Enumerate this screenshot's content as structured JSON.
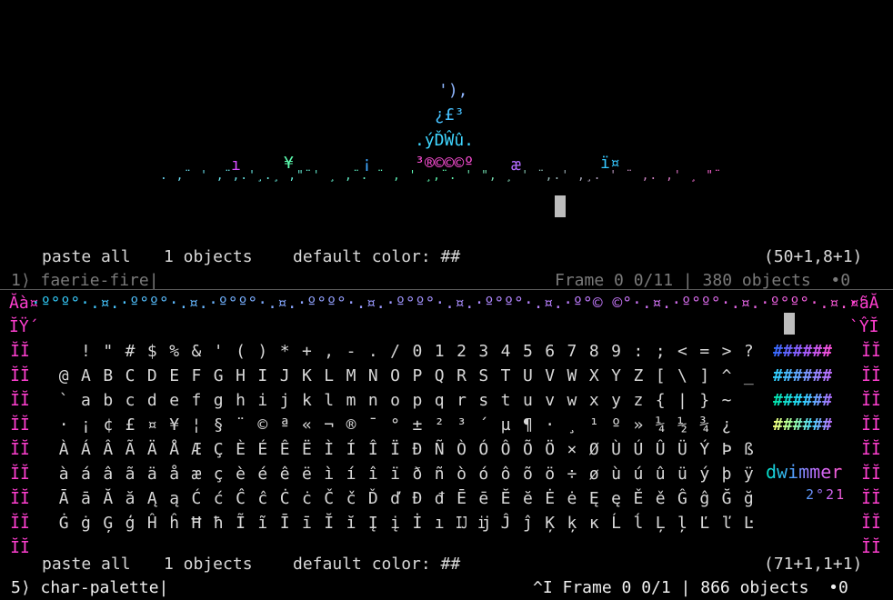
{
  "art": {
    "lines": [
      {
        "text": "'),",
        "color": "#8fb6ff"
      },
      {
        "text": "¿£³",
        "color": "#47c1ff"
      },
      {
        "text": ".ýĎŴû.",
        "color": "#3fd6ff"
      },
      {
        "text": "³®©©©º",
        "color": "#ff4fd8"
      }
    ],
    "sparkles": [
      {
        "text": "ı",
        "color": "#d84dff"
      },
      {
        "text": "¥",
        "color": "#5dffb1"
      },
      {
        "text": "¡",
        "color": "#3fa8ff"
      },
      {
        "text": "æ",
        "color": "#b36bff"
      },
      {
        "text": "ï¤",
        "color": "#36c8ff"
      }
    ],
    "dust": ". ,¨ ' ,¨,.'¸.¸ ,\"¨' ¸ ,¨. ¨ , ' ¸,¨. ' \", ¸ ' ¨,.' ,¸. ' ¨ ,. ,' ¸ \"¨ ¸ ¨,.' ,¸. ' ¨ \"¨ ' ,¨ . '¸, ¨' . , ¸",
    "dust_gradient": [
      "#6fe0ff",
      "#5dffb1",
      "#ff5ad1"
    ]
  },
  "top_pane": {
    "paste_all": "paste all",
    "objects": "1 objects",
    "default_color": "default color: ##",
    "coords": "(50+1,8+1)"
  },
  "status_1": {
    "prompt": "1⟩ faerie-fire|",
    "info": "Frame 0 0/11 | 380 objects  •0"
  },
  "palette": {
    "border_top": "·º°º°·.¤.·º°º°·.¤.·º°º°·.¤.·º°º°·.¤.·º°º°·.¤.·º°º°·.¤.·º°© ©°·.¤.·º°º°·.¤.·º°º°·.¤.·º°º°·.¤.·º°º°·.¤.·º°º°·.¤",
    "corner_left": "Ăà¤",
    "corner_right": "¤ãĂ",
    "second_left": "ĬŸ´",
    "second_right": "`ŶĬ",
    "frame_glyph": "ĬĬ",
    "rows": [
      [
        "",
        "!",
        "\"",
        "#",
        "$",
        "%",
        "&",
        "'",
        "(",
        ")",
        "*",
        "+",
        ",",
        "-",
        ".",
        "/",
        "0",
        "1",
        "2",
        "3",
        "4",
        "5",
        "6",
        "7",
        "8",
        "9",
        ":",
        ";",
        "<",
        "=",
        ">",
        "?"
      ],
      [
        "@",
        "A",
        "B",
        "C",
        "D",
        "E",
        "F",
        "G",
        "H",
        "I",
        "J",
        "K",
        "L",
        "M",
        "N",
        "O",
        "P",
        "Q",
        "R",
        "S",
        "T",
        "U",
        "V",
        "W",
        "X",
        "Y",
        "Z",
        "[",
        "\\",
        "]",
        "^",
        "_"
      ],
      [
        "`",
        "a",
        "b",
        "c",
        "d",
        "e",
        "f",
        "g",
        "h",
        "i",
        "j",
        "k",
        "l",
        "m",
        "n",
        "o",
        "p",
        "q",
        "r",
        "s",
        "t",
        "u",
        "v",
        "w",
        "x",
        "y",
        "z",
        "{",
        "|",
        "}",
        "~",
        ""
      ],
      [
        "·",
        "¡",
        "¢",
        "£",
        "¤",
        "¥",
        "¦",
        "§",
        "¨",
        "©",
        "ª",
        "«",
        "¬",
        "®",
        "¯",
        "°",
        "±",
        "²",
        "³",
        "´",
        "µ",
        "¶",
        "·",
        "¸",
        "¹",
        "º",
        "»",
        "¼",
        "½",
        "¾",
        "¿",
        ""
      ],
      [
        "À",
        "Á",
        "Â",
        "Ã",
        "Ä",
        "Å",
        "Æ",
        "Ç",
        "È",
        "É",
        "Ê",
        "Ë",
        "Ì",
        "Í",
        "Î",
        "Ï",
        "Ð",
        "Ñ",
        "Ò",
        "Ó",
        "Ô",
        "Õ",
        "Ö",
        "×",
        "Ø",
        "Ù",
        "Ú",
        "Û",
        "Ü",
        "Ý",
        "Þ",
        "ß"
      ],
      [
        "à",
        "á",
        "â",
        "ã",
        "ä",
        "å",
        "æ",
        "ç",
        "è",
        "é",
        "ê",
        "ë",
        "ì",
        "í",
        "î",
        "ï",
        "ð",
        "ñ",
        "ò",
        "ó",
        "ô",
        "õ",
        "ö",
        "÷",
        "ø",
        "ù",
        "ú",
        "û",
        "ü",
        "ý",
        "þ",
        "ÿ"
      ],
      [
        "Ā",
        "ā",
        "Ă",
        "ă",
        "Ą",
        "ą",
        "Ć",
        "ć",
        "Ĉ",
        "ĉ",
        "Ċ",
        "ċ",
        "Č",
        "č",
        "Ď",
        "ď",
        "Đ",
        "đ",
        "Ē",
        "ē",
        "Ĕ",
        "ĕ",
        "Ė",
        "ė",
        "Ę",
        "ę",
        "Ě",
        "ě",
        "Ĝ",
        "ĝ",
        "Ğ",
        "ğ"
      ],
      [
        "Ġ",
        "ġ",
        "Ģ",
        "ģ",
        "Ĥ",
        "ĥ",
        "Ħ",
        "ħ",
        "Ĩ",
        "ĩ",
        "Ī",
        "ī",
        "Ĭ",
        "ĭ",
        "Į",
        "į",
        "İ",
        "ı",
        "Ĳ",
        "ĳ",
        "Ĵ",
        "ĵ",
        "Ķ",
        "ķ",
        "ĸ",
        "Ĺ",
        "ĺ",
        "Ļ",
        "ļ",
        "Ľ",
        "ľ",
        "Ŀ"
      ]
    ],
    "swatches": [
      {
        "text": "######",
        "gradient": [
          "#2f6bff",
          "#9a5cff",
          "#ff4fd8"
        ]
      },
      {
        "text": "######",
        "gradient": [
          "#2ad4ff",
          "#6f9dff",
          "#c36bff"
        ]
      },
      {
        "text": "######",
        "gradient": [
          "#00e5a8",
          "#2ad4ff",
          "#b36bff"
        ]
      },
      {
        "text": "######",
        "gradient": [
          "#f7ff7a",
          "#9fffa0",
          "#4ad6ff",
          "#c36bff"
        ]
      }
    ],
    "brand": "dwimmer",
    "year": "2°21"
  },
  "bottom_pane": {
    "paste_all": "paste all",
    "objects": "1 objects",
    "default_color": "default color: ##",
    "coords": "(71+1,1+1)"
  },
  "status_5": {
    "prompt": "5⟩ char-palette|",
    "info": "^I Frame 0 0/1 | 866 objects  •0"
  },
  "colors": {
    "accent": "#ff3fd0",
    "text": "#d8d8d8",
    "dim": "#7a7a7a"
  }
}
